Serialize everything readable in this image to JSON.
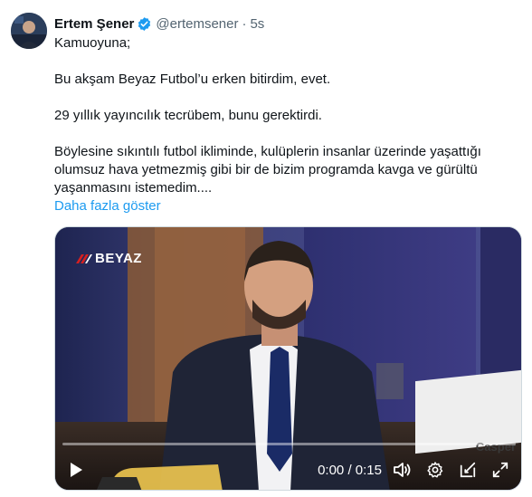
{
  "author": {
    "name": "Ertem Şener",
    "handle": "@ertemsener",
    "separator": "·",
    "time": "5s"
  },
  "tweet": {
    "paragraphs": [
      "Kamuoyuna;",
      "Bu akşam Beyaz Futbol’u erken bitirdim, evet.",
      "29 yıllık yayıncılık tecrübem, bunu gerektirdi.",
      "Böylesine sıkıntılı futbol ikliminde, kulüplerin insanlar üzerinde yaşattığı olumsuz hava yetmezmiş gibi bir de bizim programda kavga ve gürültü yaşanmasını istemedim...."
    ],
    "show_more": "Daha fazla göster"
  },
  "video": {
    "channel_logo": "BEYAZ",
    "laptop_brand": "Casper",
    "current_time": "0:00",
    "time_separator": " / ",
    "duration": "0:15",
    "progress": 0
  },
  "icons": {
    "verified": "verified-badge-icon",
    "play": "play-icon",
    "volume": "volume-icon",
    "settings": "gear-icon",
    "pip": "picture-in-picture-icon",
    "fullscreen": "fullscreen-icon"
  },
  "colors": {
    "link": "#1d9bf0",
    "verified": "#1d9bf0",
    "muted_text": "#536471"
  }
}
